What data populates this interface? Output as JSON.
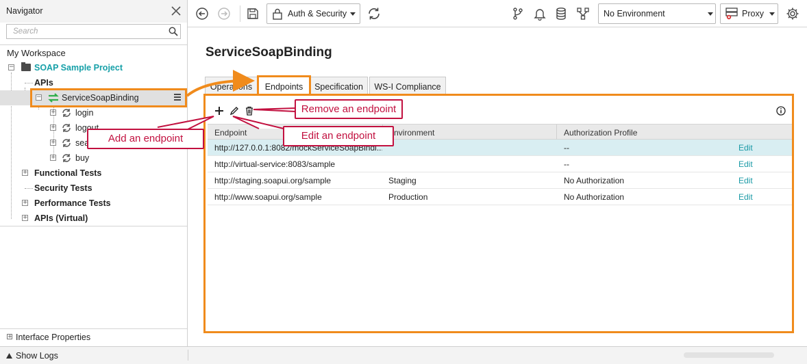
{
  "navigator": {
    "title": "Navigator",
    "search_placeholder": "Search",
    "workspace": "My Workspace",
    "project": "SOAP Sample Project",
    "apis": "APIs",
    "binding": "ServiceSoapBinding",
    "operations": [
      "login",
      "logout",
      "sea",
      "buy"
    ],
    "sections": [
      "Functional Tests",
      "Security Tests",
      "Performance Tests",
      "APIs (Virtual)"
    ],
    "interface_properties": "Interface Properties"
  },
  "statusbar": {
    "show_logs": "Show Logs"
  },
  "toolbar": {
    "auth_label": "Auth & Security",
    "environment": "No Environment",
    "proxy": "Proxy"
  },
  "main": {
    "title": "ServiceSoapBinding",
    "tabs": [
      "Operations",
      "Endpoints",
      "Specification",
      "WS-I Compliance"
    ],
    "active_tab": "Endpoints",
    "table": {
      "columns": [
        "Endpoint",
        "Environment",
        "Authorization Profile"
      ],
      "edit_label": "Edit",
      "rows": [
        {
          "endpoint": "http://127.0.0.1:8082/mockServiceSoapBindi...",
          "environment": "",
          "auth": "--"
        },
        {
          "endpoint": "http://virtual-service:8083/sample",
          "environment": "",
          "auth": "--"
        },
        {
          "endpoint": "http://staging.soapui.org/sample",
          "environment": "Staging",
          "auth": "No Authorization"
        },
        {
          "endpoint": "http://www.soapui.org/sample",
          "environment": "Production",
          "auth": "No Authorization"
        }
      ]
    }
  },
  "callouts": {
    "add": "Add an endpoint",
    "edit": "Edit an endpoint",
    "remove": "Remove an endpoint"
  },
  "colors": {
    "highlight": "#f08b1c",
    "callout": "#c2103f",
    "accent": "#16a0a8"
  }
}
